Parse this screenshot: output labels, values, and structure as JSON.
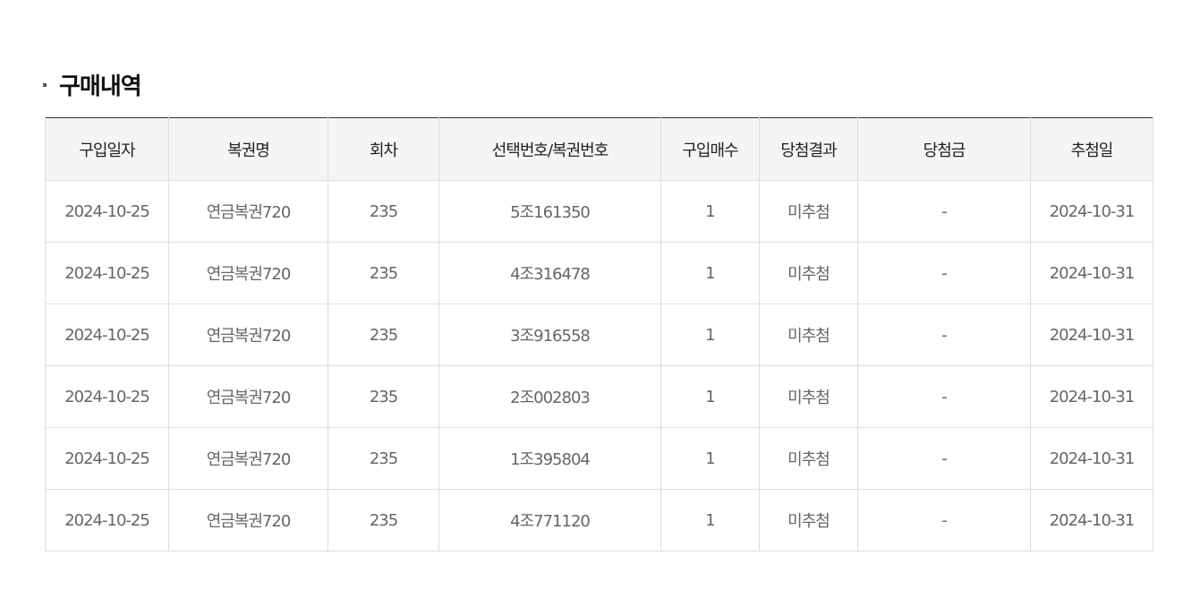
{
  "section": {
    "title": "구매내역"
  },
  "table": {
    "headers": [
      "구입일자",
      "복권명",
      "회차",
      "선택번호/복권번호",
      "구입매수",
      "당첨결과",
      "당첨금",
      "추첨일"
    ],
    "rows": [
      [
        "2024-10-25",
        "연금복권720",
        "235",
        "5조161350",
        "1",
        "미추첨",
        "-",
        "2024-10-31"
      ],
      [
        "2024-10-25",
        "연금복권720",
        "235",
        "4조316478",
        "1",
        "미추첨",
        "-",
        "2024-10-31"
      ],
      [
        "2024-10-25",
        "연금복권720",
        "235",
        "3조916558",
        "1",
        "미추첨",
        "-",
        "2024-10-31"
      ],
      [
        "2024-10-25",
        "연금복권720",
        "235",
        "2조002803",
        "1",
        "미추첨",
        "-",
        "2024-10-31"
      ],
      [
        "2024-10-25",
        "연금복권720",
        "235",
        "1조395804",
        "1",
        "미추첨",
        "-",
        "2024-10-31"
      ],
      [
        "2024-10-25",
        "연금복권720",
        "235",
        "4조771120",
        "1",
        "미추첨",
        "-",
        "2024-10-31"
      ]
    ]
  }
}
